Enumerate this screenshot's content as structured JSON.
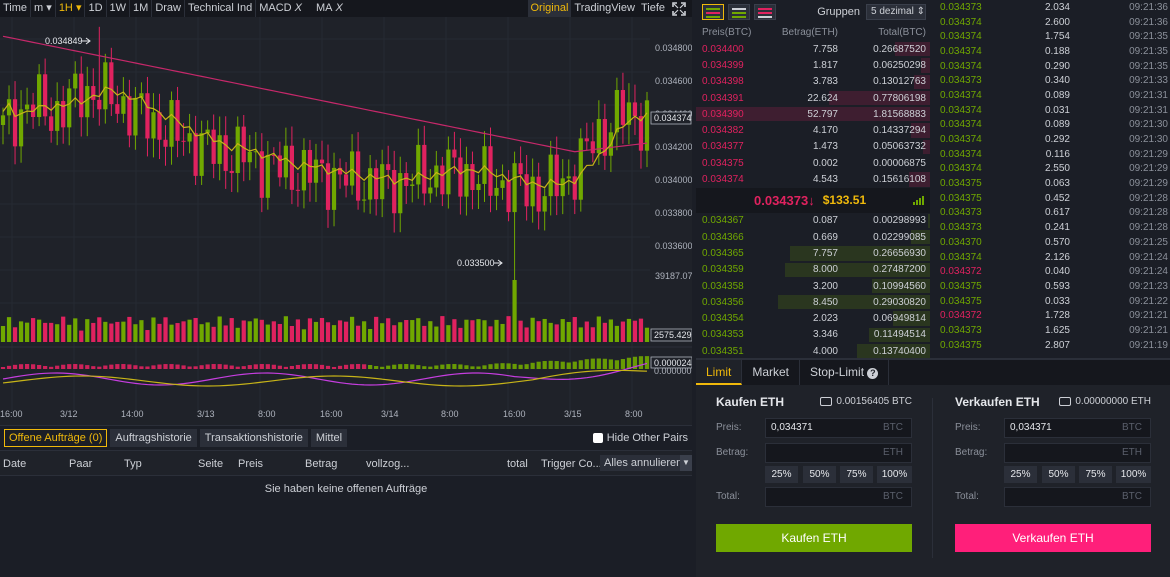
{
  "toolbar": {
    "items": [
      "Time",
      "m",
      "1H",
      "1D",
      "1W",
      "1M",
      "Draw",
      "Technical Ind",
      "MACD",
      "MA"
    ],
    "indicator_close": "X",
    "right": [
      "Original",
      "TradingView",
      "Tiefe"
    ]
  },
  "chart_data": {
    "type": "candlestick",
    "price_axis": [
      "0.034800",
      "0.034600",
      "0.034400",
      "0.034200",
      "0.034000",
      "0.033800",
      "0.033600"
    ],
    "volume_axis": "39187.07",
    "last_price_tag": "0.034374",
    "last_volume_tag": "2575.429",
    "macd_tag_1": "0.000024",
    "macd_tag_2": "0.000000",
    "high_annotation": "0.034849",
    "low_annotation": "0.033500",
    "x_ticks": [
      "16:00",
      "3/12",
      "14:00",
      "3/13",
      "8:00",
      "16:00",
      "3/14",
      "8:00",
      "16:00",
      "3/15",
      "8:00"
    ],
    "colors": {
      "up": "#70a800",
      "down": "#e0225f",
      "ma_slow": "#c6286a",
      "ma_fast": "#c7b418",
      "macd_line": "#c63ee0",
      "signal_line": "#c7b418"
    }
  },
  "orders": {
    "tabs": [
      "Offene Aufträge (0)",
      "Auftragshistorie",
      "Transaktionshistorie",
      "Mittel"
    ],
    "hide_other_pairs": "Hide Other Pairs",
    "columns": [
      "Date",
      "Paar",
      "Typ",
      "Seite",
      "Preis",
      "Betrag",
      "vollzog...",
      "total",
      "Trigger Co..."
    ],
    "cancel_all": "Alles annulieren",
    "empty": "Sie haben keine offenen Aufträge"
  },
  "book": {
    "groups_label": "Gruppen",
    "groups_value": "5 dezimal ⇕",
    "headers": [
      "Preis(BTC)",
      "Betrag(ETH)",
      "Total(BTC)"
    ],
    "asks": [
      {
        "price": "0.034400",
        "amount": "7.758",
        "total": "0.26687520",
        "depth": 0.15
      },
      {
        "price": "0.034399",
        "amount": "1.817",
        "total": "0.06250298",
        "depth": 0.04
      },
      {
        "price": "0.034398",
        "amount": "3.783",
        "total": "0.13012763",
        "depth": 0.07
      },
      {
        "price": "0.034391",
        "amount": "22.624",
        "total": "0.77806198",
        "depth": 0.43
      },
      {
        "price": "0.034390",
        "amount": "52.797",
        "total": "1.81568883",
        "depth": 1.0
      },
      {
        "price": "0.034382",
        "amount": "4.170",
        "total": "0.14337294",
        "depth": 0.08
      },
      {
        "price": "0.034377",
        "amount": "1.473",
        "total": "0.05063732",
        "depth": 0.03
      },
      {
        "price": "0.034375",
        "amount": "0.002",
        "total": "0.00006875",
        "depth": 0.0
      },
      {
        "price": "0.034374",
        "amount": "4.543",
        "total": "0.15616108",
        "depth": 0.09
      }
    ],
    "mid_price": "0.034373",
    "mid_arrow": "↓",
    "mid_usd": "$133.51",
    "bids": [
      {
        "price": "0.034367",
        "amount": "0.087",
        "total": "0.00298993",
        "depth": 0.01
      },
      {
        "price": "0.034366",
        "amount": "0.669",
        "total": "0.02299085",
        "depth": 0.08
      },
      {
        "price": "0.034365",
        "amount": "7.757",
        "total": "0.26656930",
        "depth": 0.6
      },
      {
        "price": "0.034359",
        "amount": "8.000",
        "total": "0.27487200",
        "depth": 0.62
      },
      {
        "price": "0.034358",
        "amount": "3.200",
        "total": "0.10994560",
        "depth": 0.25
      },
      {
        "price": "0.034356",
        "amount": "8.450",
        "total": "0.29030820",
        "depth": 0.65
      },
      {
        "price": "0.034354",
        "amount": "2.023",
        "total": "0.06949814",
        "depth": 0.16
      },
      {
        "price": "0.034353",
        "amount": "3.346",
        "total": "0.11494514",
        "depth": 0.26
      },
      {
        "price": "0.034351",
        "amount": "4.000",
        "total": "0.13740400",
        "depth": 0.31
      }
    ]
  },
  "trades": [
    {
      "price": "0.034373",
      "amount": "2.034",
      "time": "09:21:36",
      "side": "buy"
    },
    {
      "price": "0.034374",
      "amount": "2.600",
      "time": "09:21:36",
      "side": "buy"
    },
    {
      "price": "0.034374",
      "amount": "1.754",
      "time": "09:21:35",
      "side": "buy"
    },
    {
      "price": "0.034374",
      "amount": "0.188",
      "time": "09:21:35",
      "side": "buy"
    },
    {
      "price": "0.034374",
      "amount": "0.290",
      "time": "09:21:35",
      "side": "buy"
    },
    {
      "price": "0.034373",
      "amount": "0.340",
      "time": "09:21:33",
      "side": "buy"
    },
    {
      "price": "0.034374",
      "amount": "0.089",
      "time": "09:21:31",
      "side": "buy"
    },
    {
      "price": "0.034374",
      "amount": "0.031",
      "time": "09:21:31",
      "side": "buy"
    },
    {
      "price": "0.034374",
      "amount": "0.089",
      "time": "09:21:30",
      "side": "buy"
    },
    {
      "price": "0.034374",
      "amount": "0.292",
      "time": "09:21:30",
      "side": "buy"
    },
    {
      "price": "0.034374",
      "amount": "0.116",
      "time": "09:21:29",
      "side": "buy"
    },
    {
      "price": "0.034374",
      "amount": "2.550",
      "time": "09:21:29",
      "side": "buy"
    },
    {
      "price": "0.034375",
      "amount": "0.063",
      "time": "09:21:29",
      "side": "buy"
    },
    {
      "price": "0.034375",
      "amount": "0.452",
      "time": "09:21:28",
      "side": "buy"
    },
    {
      "price": "0.034373",
      "amount": "0.617",
      "time": "09:21:28",
      "side": "buy"
    },
    {
      "price": "0.034373",
      "amount": "0.241",
      "time": "09:21:28",
      "side": "buy"
    },
    {
      "price": "0.034370",
      "amount": "0.570",
      "time": "09:21:25",
      "side": "buy"
    },
    {
      "price": "0.034374",
      "amount": "2.126",
      "time": "09:21:24",
      "side": "buy"
    },
    {
      "price": "0.034372",
      "amount": "0.040",
      "time": "09:21:24",
      "side": "sell"
    },
    {
      "price": "0.034375",
      "amount": "0.593",
      "time": "09:21:23",
      "side": "buy"
    },
    {
      "price": "0.034375",
      "amount": "0.033",
      "time": "09:21:22",
      "side": "buy"
    },
    {
      "price": "0.034372",
      "amount": "1.728",
      "time": "09:21:21",
      "side": "sell"
    },
    {
      "price": "0.034373",
      "amount": "1.625",
      "time": "09:21:21",
      "side": "buy"
    },
    {
      "price": "0.034375",
      "amount": "2.807",
      "time": "09:21:19",
      "side": "buy"
    }
  ],
  "form": {
    "tabs": [
      "Limit",
      "Market",
      "Stop-Limit"
    ],
    "buy": {
      "title": "Kaufen ETH",
      "balance": "0.00156405 BTC",
      "price_label": "Preis:",
      "price_value": "0,034371",
      "price_unit": "BTC",
      "amount_label": "Betrag:",
      "amount_unit": "ETH",
      "percent": [
        "25%",
        "50%",
        "75%",
        "100%"
      ],
      "total_label": "Total:",
      "total_unit": "BTC",
      "button": "Kaufen ETH"
    },
    "sell": {
      "title": "Verkaufen ETH",
      "balance": "0.00000000 ETH",
      "price_label": "Preis:",
      "price_value": "0,034371",
      "price_unit": "BTC",
      "amount_label": "Betrag:",
      "amount_unit": "ETH",
      "percent": [
        "25%",
        "50%",
        "75%",
        "100%"
      ],
      "total_label": "Total:",
      "total_unit": "BTC",
      "button": "Verkaufen ETH"
    },
    "colors": {
      "buy": "#70a800",
      "sell": "#ff1f7a"
    }
  }
}
